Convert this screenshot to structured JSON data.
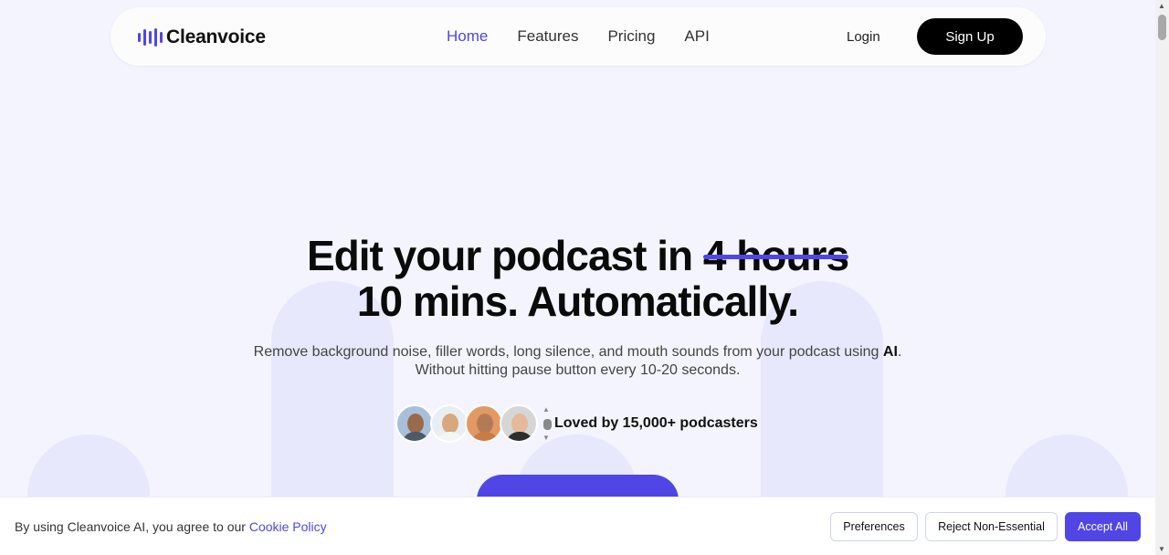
{
  "nav": {
    "logo_text": "Cleanvoice",
    "links": [
      {
        "label": "Home",
        "active": true
      },
      {
        "label": "Features",
        "active": false
      },
      {
        "label": "Pricing",
        "active": false
      },
      {
        "label": "API",
        "active": false
      }
    ],
    "login_label": "Login",
    "signup_label": "Sign Up"
  },
  "hero": {
    "title_prefix": "Edit your podcast in",
    "title_struck": "4 hours",
    "title_line2": "10 mins. Automatically.",
    "subtitle_part1": "Remove background noise, filler words, long silence, and mouth sounds from your podcast using",
    "subtitle_bold": "AI",
    "subtitle_part2": "Without hitting pause button every 10-20 seconds.",
    "social_proof": "Loved by 15,000+ podcasters",
    "cta_label": ""
  },
  "cookie": {
    "text": "By using Cleanvoice AI, you agree to our",
    "link": "Cookie Policy",
    "preferences": "Preferences",
    "reject": "Reject Non-Essential",
    "accept": "Accept All"
  },
  "colors": {
    "accent": "#4f46e5",
    "background": "#f3f4fe",
    "shape": "#e7e8fb"
  }
}
